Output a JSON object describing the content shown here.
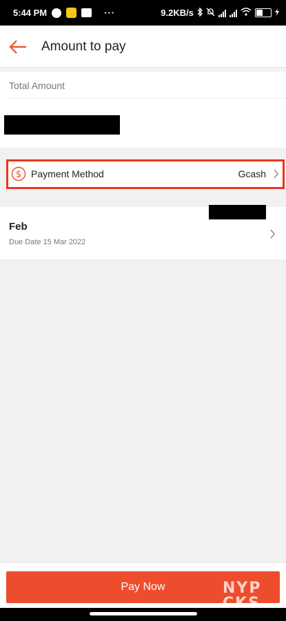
{
  "status_bar": {
    "time": "5:44 PM",
    "more": "···",
    "net_speed": "9.2KB/s"
  },
  "header": {
    "title": "Amount to pay",
    "back_icon": "arrow-left-icon"
  },
  "total": {
    "label": "Total Amount"
  },
  "payment_method": {
    "label": "Payment Method",
    "value": "Gcash",
    "icon": "dollar-circle-icon"
  },
  "bill": {
    "month": "Feb",
    "due_date": "Due Date 15 Mar 2022"
  },
  "footer": {
    "pay_label": "Pay Now"
  },
  "watermark": {
    "line1": "NYP",
    "line2": "CKS"
  },
  "colors": {
    "accent": "#ee4d2d",
    "highlight_border": "#e8371e"
  }
}
